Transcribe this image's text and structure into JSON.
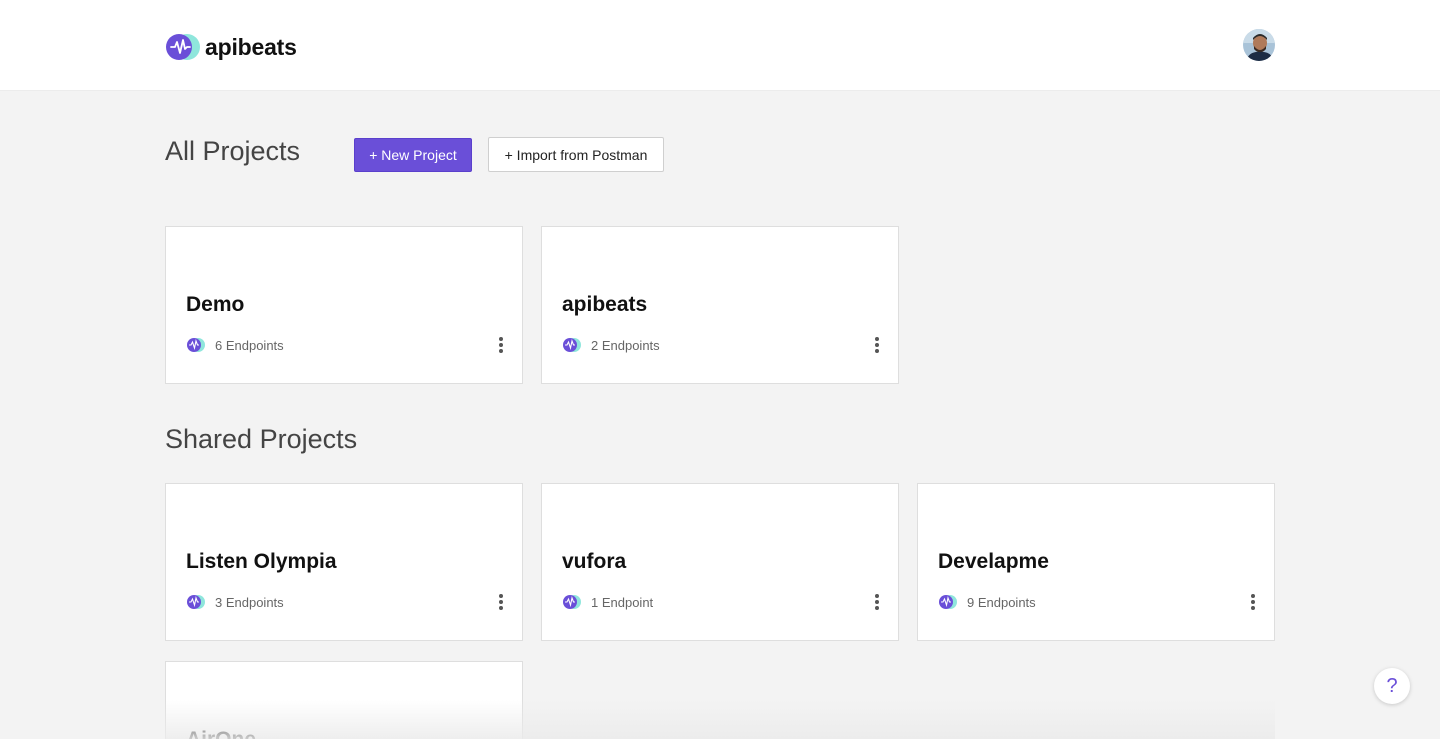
{
  "app": {
    "name": "apibeats"
  },
  "header": {
    "logo_icon": "apibeats-logo-icon",
    "avatar_icon": "user-avatar"
  },
  "all_projects": {
    "title": "All Projects",
    "new_project_label": "+ New Project",
    "import_label": "+ Import from Postman",
    "projects": [
      {
        "name": "Demo",
        "endpoints": "6 Endpoints"
      },
      {
        "name": "apibeats",
        "endpoints": "2 Endpoints"
      }
    ]
  },
  "shared_projects": {
    "title": "Shared Projects",
    "projects": [
      {
        "name": "Listen Olympia",
        "endpoints": "3 Endpoints"
      },
      {
        "name": "vufora",
        "endpoints": "1 Endpoint"
      },
      {
        "name": "Develapme",
        "endpoints": "9 Endpoints"
      },
      {
        "name": "AirOne",
        "endpoints": ""
      }
    ]
  },
  "help": {
    "label": "?"
  },
  "colors": {
    "accent": "#6a4fd8",
    "logo_teal": "#7fe3da",
    "background": "#f3f3f3"
  }
}
